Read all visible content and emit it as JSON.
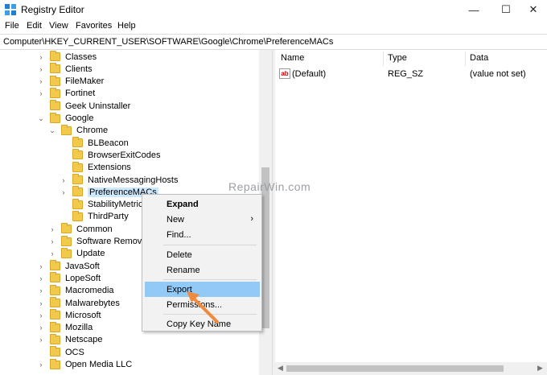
{
  "window": {
    "title": "Registry Editor",
    "minimize": "—",
    "maximize": "☐",
    "close": "✕"
  },
  "menu": [
    "File",
    "Edit",
    "View",
    "Favorites",
    "Help"
  ],
  "address": "Computer\\HKEY_CURRENT_USER\\SOFTWARE\\Google\\Chrome\\PreferenceMACs",
  "tree": [
    {
      "label": "Classes",
      "level": 0,
      "expander": "›"
    },
    {
      "label": "Clients",
      "level": 0,
      "expander": "›"
    },
    {
      "label": "FileMaker",
      "level": 0,
      "expander": "›"
    },
    {
      "label": "Fortinet",
      "level": 0,
      "expander": "›"
    },
    {
      "label": "Geek Uninstaller",
      "level": 0,
      "expander": ""
    },
    {
      "label": "Google",
      "level": 0,
      "expander": "⌄"
    },
    {
      "label": "Chrome",
      "level": 1,
      "expander": "⌄"
    },
    {
      "label": "BLBeacon",
      "level": 2,
      "expander": ""
    },
    {
      "label": "BrowserExitCodes",
      "level": 2,
      "expander": ""
    },
    {
      "label": "Extensions",
      "level": 2,
      "expander": ""
    },
    {
      "label": "NativeMessagingHosts",
      "level": 2,
      "expander": "›"
    },
    {
      "label": "PreferenceMACs",
      "level": 2,
      "expander": "›",
      "selected": true
    },
    {
      "label": "StabilityMetrics",
      "level": 2,
      "expander": ""
    },
    {
      "label": "ThirdParty",
      "level": 2,
      "expander": ""
    },
    {
      "label": "Common",
      "level": 1,
      "expander": "›"
    },
    {
      "label": "Software Removal T",
      "level": 1,
      "expander": "›"
    },
    {
      "label": "Update",
      "level": 1,
      "expander": "›"
    },
    {
      "label": "JavaSoft",
      "level": 0,
      "expander": "›"
    },
    {
      "label": "LopeSoft",
      "level": 0,
      "expander": "›"
    },
    {
      "label": "Macromedia",
      "level": 0,
      "expander": "›"
    },
    {
      "label": "Malwarebytes",
      "level": 0,
      "expander": "›"
    },
    {
      "label": "Microsoft",
      "level": 0,
      "expander": "›"
    },
    {
      "label": "Mozilla",
      "level": 0,
      "expander": "›"
    },
    {
      "label": "Netscape",
      "level": 0,
      "expander": "›"
    },
    {
      "label": "OCS",
      "level": 0,
      "expander": ""
    },
    {
      "label": "Open Media LLC",
      "level": 0,
      "expander": "›"
    }
  ],
  "columns": {
    "name": "Name",
    "type": "Type",
    "data": "Data"
  },
  "values": [
    {
      "icon": "ab",
      "name": "(Default)",
      "type": "REG_SZ",
      "data": "(value not set)"
    }
  ],
  "watermark": "RepairWin.com",
  "context_menu": {
    "expand": "Expand",
    "new": "New",
    "new_arrow": "›",
    "find": "Find...",
    "delete": "Delete",
    "rename": "Rename",
    "export": "Export",
    "permissions": "Permissions...",
    "copy_key_name": "Copy Key Name"
  },
  "colors": {
    "selection": "#cce8ff",
    "menu_highlight": "#91c9f7",
    "arrow": "#f08a3c"
  }
}
